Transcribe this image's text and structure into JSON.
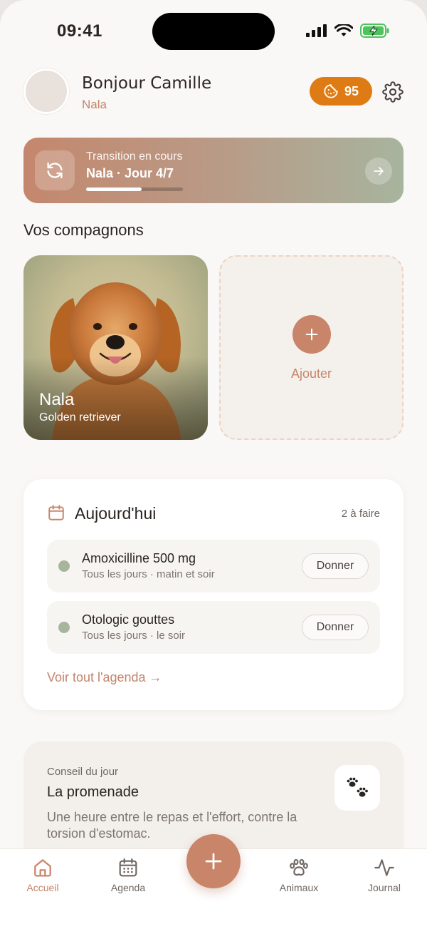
{
  "status_bar": {
    "time": "09:41"
  },
  "header": {
    "greeting": "Bonjour Camille",
    "pet_name": "Nala",
    "points": "95"
  },
  "banner": {
    "label": "Transition en cours",
    "title": "Nala · Jour 4/7",
    "progress": 0.57
  },
  "companions": {
    "title": "Vos compagnons",
    "pets": [
      {
        "name": "Nala",
        "breed": "Golden retriever"
      }
    ],
    "add_label": "Ajouter"
  },
  "today": {
    "title": "Aujourd'hui",
    "count": "2 à faire",
    "tasks": [
      {
        "title": "Amoxicilline 500 mg",
        "schedule": "Tous les jours · matin et soir",
        "action": "Donner"
      },
      {
        "title": "Otologic gouttes",
        "schedule": "Tous les jours · le soir",
        "action": "Donner"
      }
    ],
    "link": "Voir tout l'agenda →"
  },
  "tip": {
    "label": "Conseil du jour",
    "title": "La promenade",
    "text": "Une heure entre le repas et l'effort, contre la torsion d'estomac."
  },
  "tabbar": {
    "items": [
      {
        "label": "Accueil",
        "icon": "home-icon",
        "active": true
      },
      {
        "label": "Agenda",
        "icon": "calendar-icon"
      },
      {
        "label": "Animaux",
        "icon": "paw-icon"
      },
      {
        "label": "Journal",
        "icon": "activity-icon"
      }
    ]
  },
  "colors": {
    "accent": "#c8856a",
    "points_badge": "#df7b14",
    "task_dot": "#a8b59d"
  }
}
